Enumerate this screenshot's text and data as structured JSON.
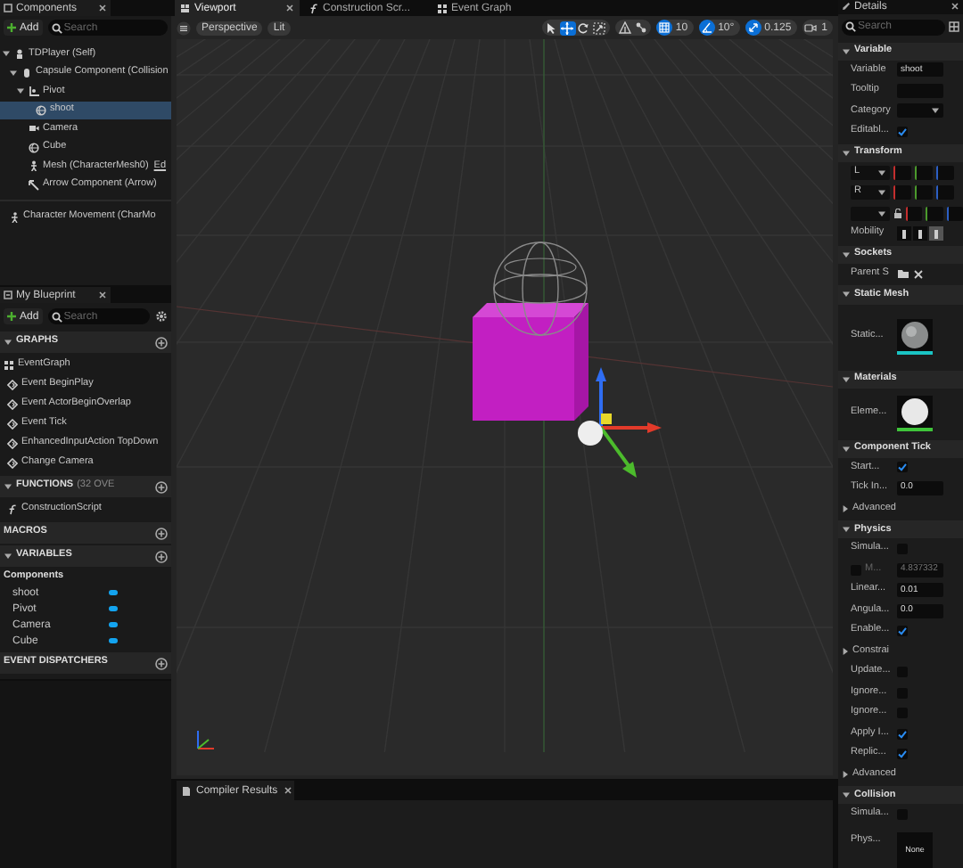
{
  "components_panel": {
    "title": "Components",
    "add_label": "Add",
    "search_placeholder": "Search",
    "tree": [
      {
        "kind": "actor",
        "label": "TDPlayer (Self)",
        "selected": false,
        "children": [
          {
            "kind": "capsule",
            "label": "Capsule Component (Collision",
            "selected": false,
            "children": [
              {
                "kind": "pivot",
                "label": "Pivot",
                "selected": false,
                "children": [
                  {
                    "kind": "sphere",
                    "label": "shoot",
                    "selected": true
                  }
                ]
              },
              {
                "kind": "camera",
                "label": "Camera",
                "selected": false
              },
              {
                "kind": "sphere",
                "label": "Cube",
                "selected": false
              },
              {
                "kind": "mesh",
                "label": "Mesh (CharacterMesh0)",
                "link": "Ed",
                "selected": false
              },
              {
                "kind": "arrow",
                "label": "Arrow Component (Arrow)",
                "selected": false
              }
            ]
          }
        ]
      }
    ],
    "movement": [
      {
        "label": "Character Movement (CharMo"
      }
    ]
  },
  "blueprint_panel": {
    "title": "My Blueprint",
    "add_label": "Add",
    "search_placeholder": "Search",
    "sections": [
      {
        "title": "GRAPHS",
        "expanded": true,
        "items": [
          {
            "kind": "graph",
            "label": "EventGraph"
          },
          {
            "kind": "event",
            "label": "Event BeginPlay"
          },
          {
            "kind": "event",
            "label": "Event ActorBeginOverlap"
          },
          {
            "kind": "event",
            "label": "Event Tick"
          },
          {
            "kind": "event",
            "label": "EnhancedInputAction TopDown"
          },
          {
            "kind": "event",
            "label": "Change Camera"
          }
        ]
      },
      {
        "title": "FUNCTIONS",
        "note": "(32 OVE",
        "expanded": true,
        "items": [
          {
            "kind": "function",
            "label": "ConstructionScript"
          }
        ]
      },
      {
        "title": "MACROS",
        "expanded": false
      },
      {
        "title": "VARIABLES",
        "expanded": true,
        "category": "Components",
        "items": [
          {
            "kind": "variable",
            "label": "shoot"
          },
          {
            "kind": "variable",
            "label": "Pivot"
          },
          {
            "kind": "variable",
            "label": "Camera"
          },
          {
            "kind": "variable",
            "label": "Cube"
          }
        ]
      },
      {
        "title": "EVENT DISPATCHERS",
        "expanded": false
      }
    ]
  },
  "editor_tabs": [
    {
      "kind": "viewport",
      "label": "Viewport",
      "selected": true
    },
    {
      "kind": "function",
      "label": "Construction Scr...",
      "selected": false
    },
    {
      "kind": "graph",
      "label": "Event Graph",
      "selected": false
    }
  ],
  "viewport_toolbar": {
    "view_mode": "Perspective",
    "lighting": "Lit",
    "tools": [
      {
        "kind": "select",
        "selected": false
      },
      {
        "kind": "move",
        "selected": true
      },
      {
        "kind": "rotate",
        "selected": false
      },
      {
        "kind": "scale",
        "selected": false
      }
    ],
    "snaps": [
      {
        "kind": "grid",
        "value": "10",
        "on": true
      },
      {
        "kind": "angle",
        "value": "10°",
        "on": true
      },
      {
        "kind": "scale",
        "value": "0.125",
        "on": true
      },
      {
        "kind": "camera",
        "value": "1",
        "on": false
      }
    ]
  },
  "bottom_tabs": [
    {
      "label": "Compiler Results"
    }
  ],
  "details": {
    "title": "Details",
    "search_placeholder": "Search",
    "sections": [
      {
        "title": "Variable",
        "expanded": true,
        "rows": [
          {
            "kind": "text",
            "label": "Variable",
            "value": "shoot"
          },
          {
            "kind": "text",
            "label": "Tooltip"
          },
          {
            "kind": "dropdown",
            "label": "Category"
          },
          {
            "kind": "checkbox",
            "label": "Editabl...",
            "checked": true
          }
        ]
      },
      {
        "title": "Transform",
        "expanded": true,
        "rows": [
          {
            "kind": "vector",
            "label": "L"
          },
          {
            "kind": "vector",
            "label": "R"
          },
          {
            "kind": "vector_lock"
          },
          {
            "kind": "segmented",
            "label": "Mobility",
            "options": [
              {
                "selected": false
              },
              {
                "selected": false
              },
              {
                "selected": true
              }
            ]
          }
        ]
      },
      {
        "title": "Sockets",
        "expanded": true,
        "rows": [
          {
            "kind": "socket",
            "label": "Parent S"
          }
        ]
      },
      {
        "title": "Static Mesh",
        "expanded": true,
        "rows": [
          {
            "kind": "mesh_asset",
            "label": "Static..."
          }
        ]
      },
      {
        "title": "Materials",
        "expanded": true,
        "rows": [
          {
            "kind": "material_asset",
            "label": "Eleme..."
          }
        ]
      },
      {
        "title": "Component Tick",
        "expanded": true,
        "rows": [
          {
            "kind": "checkbox",
            "label": "Start...",
            "checked": true
          },
          {
            "kind": "text",
            "label": "Tick In...",
            "value": "0.0"
          },
          {
            "kind": "group",
            "label": "Advanced",
            "expanded": false
          }
        ]
      },
      {
        "title": "Physics",
        "expanded": true,
        "rows": [
          {
            "kind": "checkbox",
            "label": "Simula...",
            "checked": false
          },
          {
            "kind": "check_text",
            "label": "M...",
            "checked": false,
            "value": "4.837332",
            "disabled": true
          },
          {
            "kind": "text",
            "label": "Linear...",
            "value": "0.01"
          },
          {
            "kind": "text",
            "label": "Angula...",
            "value": "0.0"
          },
          {
            "kind": "checkbox",
            "label": "Enable...",
            "checked": true
          },
          {
            "kind": "group",
            "label": "Constrai",
            "expanded": false
          },
          {
            "kind": "checkbox",
            "label": "Update...",
            "checked": false
          },
          {
            "kind": "checkbox",
            "label": "Ignore...",
            "checked": false
          },
          {
            "kind": "checkbox",
            "label": "Ignore...",
            "checked": false
          },
          {
            "kind": "checkbox",
            "label": "Apply I...",
            "checked": true
          },
          {
            "kind": "checkbox",
            "label": "Replic...",
            "checked": true
          },
          {
            "kind": "group",
            "label": "Advanced",
            "expanded": false
          }
        ]
      },
      {
        "title": "Collision",
        "expanded": true,
        "rows": [
          {
            "kind": "checkbox",
            "label": "Simula...",
            "checked": false
          },
          {
            "kind": "asset_text",
            "label": "Phys...",
            "value": "None"
          }
        ]
      }
    ]
  }
}
